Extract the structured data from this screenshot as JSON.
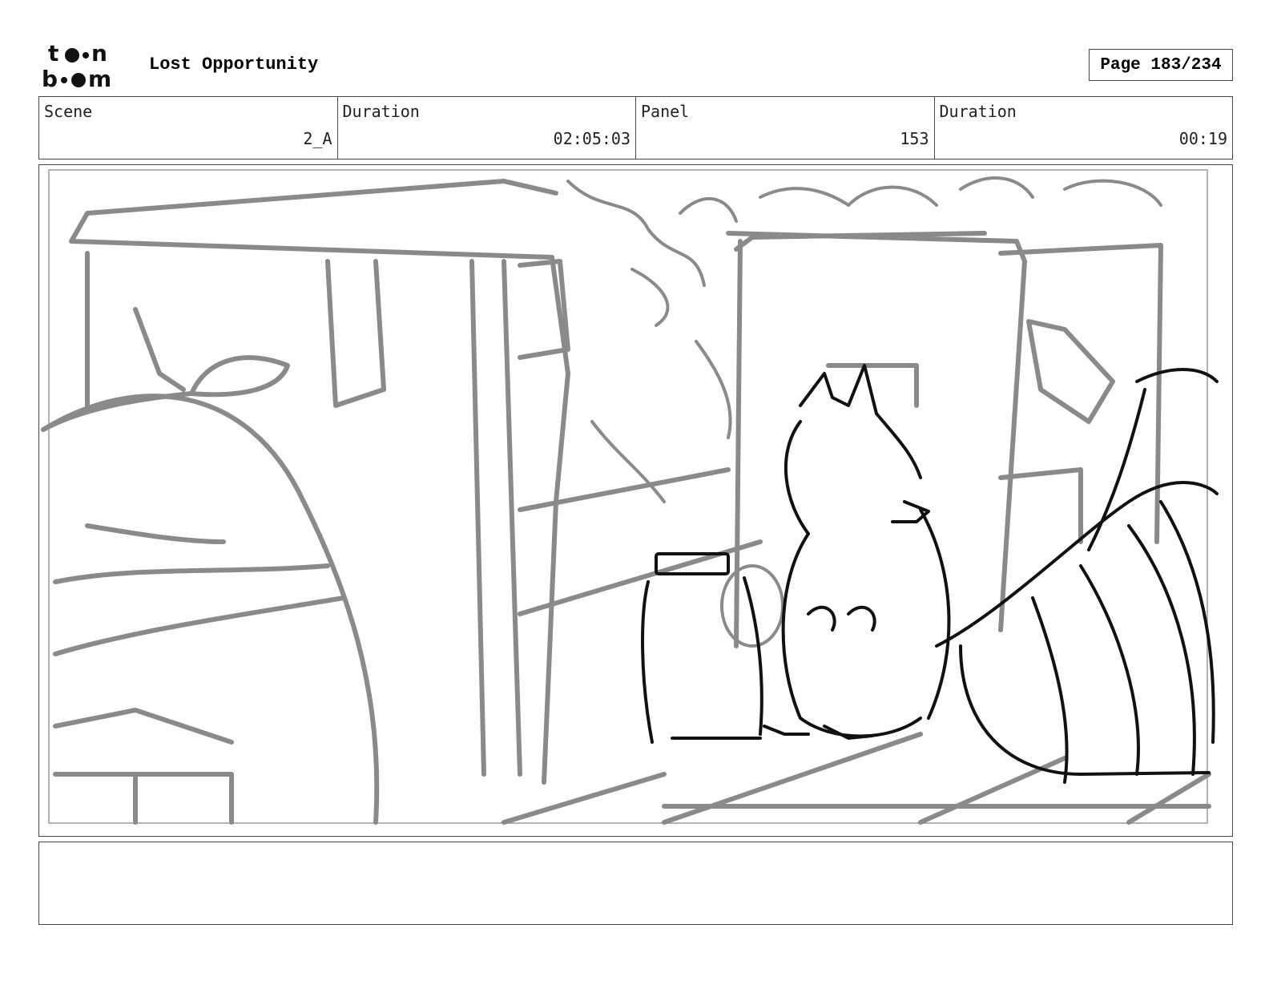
{
  "header": {
    "logo_text": "toon boom",
    "title": "Lost Opportunity",
    "page": "Page 183/234"
  },
  "info": {
    "scene_label": "Scene",
    "scene_value": "2_A",
    "scene_duration_label": "Duration",
    "scene_duration_value": "02:05:03",
    "panel_label": "Panel",
    "panel_value": "153",
    "panel_duration_label": "Duration",
    "panel_duration_value": "00:19"
  },
  "notes": {
    "text": ""
  }
}
